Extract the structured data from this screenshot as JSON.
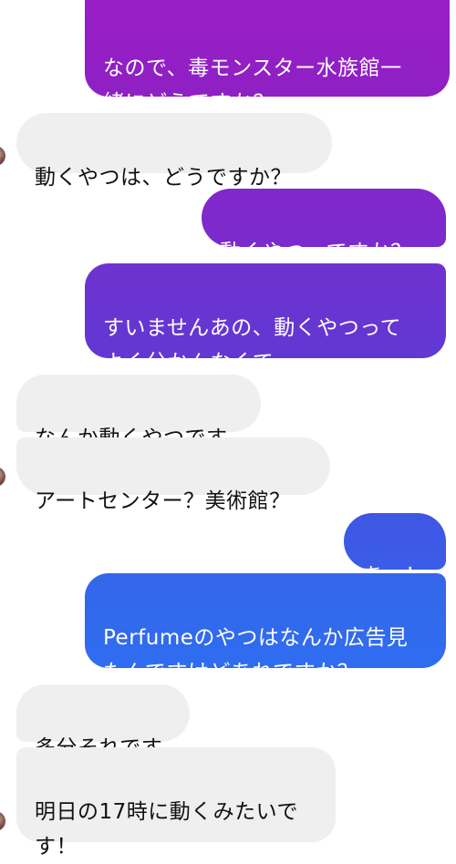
{
  "messages": [
    {
      "side": "out",
      "text": "なので、毒モンスター水族館一\n緒にどうですか？"
    },
    {
      "side": "in",
      "text": "動くやつは、どうですか？"
    },
    {
      "side": "out",
      "text": "動くやつ、ですか？"
    },
    {
      "side": "out",
      "text": "すいませんあの、動くやつって\nよく分かんなくて......"
    },
    {
      "side": "in",
      "text": "なんか動くやつです"
    },
    {
      "side": "in",
      "text": "アートセンター？美術館？"
    },
    {
      "side": "out",
      "text": "あー！"
    },
    {
      "side": "out",
      "text": "Perfumeのやつはなんか広告見\nたんですけどあれですか？"
    },
    {
      "side": "in",
      "text": "多分それです"
    },
    {
      "side": "in",
      "text": "明日の17時に動くみたいで\nす！"
    }
  ],
  "colors": {
    "incoming_bg": "#efefef",
    "outgoing_gradient_top": "#9a1fc2",
    "outgoing_gradient_bottom": "#2f6df0"
  }
}
